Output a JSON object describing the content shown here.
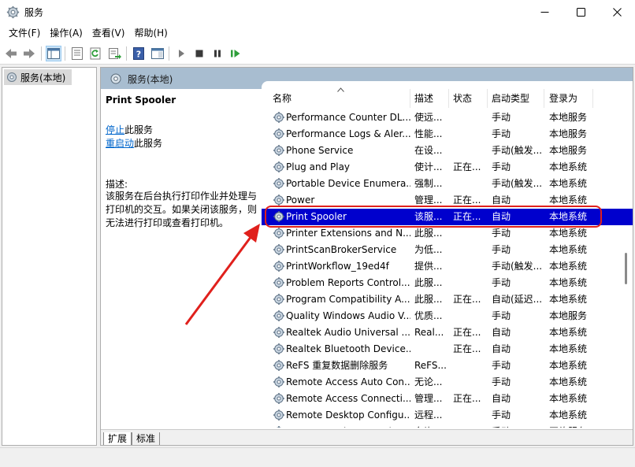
{
  "window": {
    "title": "服务"
  },
  "menu": [
    "文件(F)",
    "操作(A)",
    "查看(V)",
    "帮助(H)"
  ],
  "tree": {
    "root_label": "服务(本地)"
  },
  "pane": {
    "header": "服务(本地)",
    "selected_service": "Print Spooler",
    "stop_link": "停止",
    "stop_suffix": "此服务",
    "restart_link": "重启动",
    "restart_suffix": "此服务",
    "desc_label": "描述:",
    "desc_lines": [
      "该服务在后台执行打印作业并处理与",
      "打印机的交互。如果关闭该服务，则",
      "无法进行打印或查看打印机。"
    ]
  },
  "columns": {
    "name": "名称",
    "desc": "描述",
    "status": "状态",
    "start": "启动类型",
    "logon": "登录为"
  },
  "services": [
    {
      "name": "Performance Counter DL...",
      "desc": "使远...",
      "status": "",
      "start": "手动",
      "logon": "本地服务"
    },
    {
      "name": "Performance Logs & Aler...",
      "desc": "性能...",
      "status": "",
      "start": "手动",
      "logon": "本地服务"
    },
    {
      "name": "Phone Service",
      "desc": "在设...",
      "status": "",
      "start": "手动(触发...",
      "logon": "本地服务"
    },
    {
      "name": "Plug and Play",
      "desc": "使计...",
      "status": "正在...",
      "start": "手动",
      "logon": "本地系统"
    },
    {
      "name": "Portable Device Enumera...",
      "desc": "强制...",
      "status": "",
      "start": "手动(触发...",
      "logon": "本地系统"
    },
    {
      "name": "Power",
      "desc": "管理...",
      "status": "正在...",
      "start": "自动",
      "logon": "本地系统"
    },
    {
      "name": "Print Spooler",
      "desc": "该服...",
      "status": "正在...",
      "start": "自动",
      "logon": "本地系统",
      "selected": true
    },
    {
      "name": "Printer Extensions and N...",
      "desc": "此服...",
      "status": "",
      "start": "手动",
      "logon": "本地系统"
    },
    {
      "name": "PrintScanBrokerService",
      "desc": "为低...",
      "status": "",
      "start": "手动",
      "logon": "本地系统"
    },
    {
      "name": "PrintWorkflow_19ed4f",
      "desc": "提供...",
      "status": "",
      "start": "手动(触发...",
      "logon": "本地系统"
    },
    {
      "name": "Problem Reports Control...",
      "desc": "此服...",
      "status": "",
      "start": "手动",
      "logon": "本地系统"
    },
    {
      "name": "Program Compatibility A...",
      "desc": "此服...",
      "status": "正在...",
      "start": "自动(延迟...",
      "logon": "本地系统"
    },
    {
      "name": "Quality Windows Audio V...",
      "desc": "优质...",
      "status": "",
      "start": "手动",
      "logon": "本地服务"
    },
    {
      "name": "Realtek Audio Universal ...",
      "desc": "Real...",
      "status": "正在...",
      "start": "自动",
      "logon": "本地系统"
    },
    {
      "name": "Realtek Bluetooth Device...",
      "desc": "",
      "status": "正在...",
      "start": "自动",
      "logon": "本地系统"
    },
    {
      "name": "ReFS 重复数据删除服务",
      "desc": "ReFS...",
      "status": "",
      "start": "手动",
      "logon": "本地系统"
    },
    {
      "name": "Remote Access Auto Con...",
      "desc": "无论...",
      "status": "",
      "start": "手动",
      "logon": "本地系统"
    },
    {
      "name": "Remote Access Connecti...",
      "desc": "管理...",
      "status": "正在...",
      "start": "自动",
      "logon": "本地系统"
    },
    {
      "name": "Remote Desktop Configu...",
      "desc": "远程...",
      "status": "",
      "start": "手动",
      "logon": "本地系统"
    },
    {
      "name": "Remote Desktop Services",
      "desc": "允许...",
      "status": "",
      "start": "手动",
      "logon": "网络服务"
    }
  ],
  "tabs": [
    "扩展",
    "标准"
  ],
  "colors": {
    "selection": "#0000cd",
    "pane_header": "#a8bdd0",
    "annotation_red": "#e0201c",
    "link": "#0066cc"
  }
}
